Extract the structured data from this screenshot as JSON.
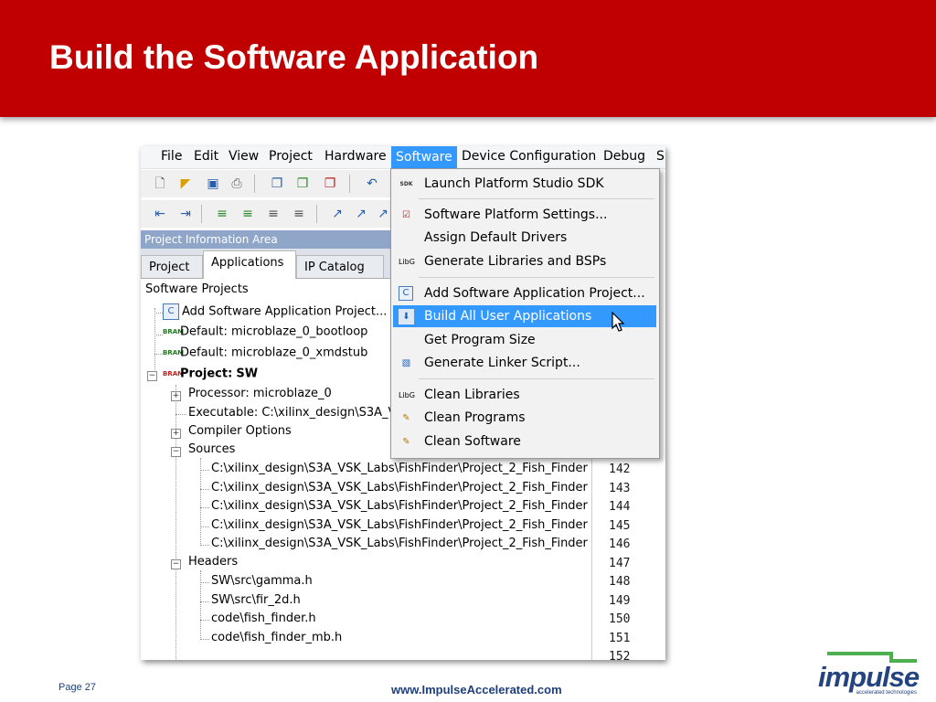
{
  "slide": {
    "title": "Build the Software Application",
    "page": "Page 27",
    "url": "www.ImpulseAccelerated.com",
    "logo_text": "impulse",
    "logo_tagline": "accelerated technologies",
    "header_color": "#c00000"
  },
  "menubar": [
    "File",
    "Edit",
    "View",
    "Project",
    "Hardware",
    "Software",
    "Device Configuration",
    "Debug",
    "S"
  ],
  "active_menu": "Software",
  "project_area": {
    "title": "Project Information Area",
    "tabs": [
      "Project",
      "Applications",
      "IP Catalog"
    ],
    "selected_tab": "Applications"
  },
  "tree": {
    "header": "Software Projects",
    "add_item": "Add Software Application Project...",
    "default1": "Default: microblaze_0_bootloop",
    "default2": "Default: microblaze_0_xmdstub",
    "project_label": "Project",
    "project_sep": ":",
    "project_name": "SW",
    "processor": "Processor: microblaze_0",
    "executable": "Executable: C:\\xilinx_design\\S3A_V",
    "compiler": "Compiler Options",
    "sources": "Sources",
    "source_files": [
      "C:\\xilinx_design\\S3A_VSK_Labs\\FishFinder\\Project_2_Fish_Finder",
      "C:\\xilinx_design\\S3A_VSK_Labs\\FishFinder\\Project_2_Fish_Finder",
      "C:\\xilinx_design\\S3A_VSK_Labs\\FishFinder\\Project_2_Fish_Finder",
      "C:\\xilinx_design\\S3A_VSK_Labs\\FishFinder\\Project_2_Fish_Finder",
      "C:\\xilinx_design\\S3A_VSK_Labs\\FishFinder\\Project_2_Fish_Finder"
    ],
    "headers": "Headers",
    "header_files": [
      "SW\\src\\gamma.h",
      "SW\\src\\fir_2d.h",
      "code\\fish_finder.h",
      "code\\fish_finder_mb.h"
    ]
  },
  "line_numbers": [
    "142",
    "143",
    "144",
    "145",
    "146",
    "147",
    "148",
    "149",
    "150",
    "151",
    "152"
  ],
  "software_menu": {
    "launch": "Launch Platform Studio SDK",
    "platform_settings": "Software Platform Settings...",
    "assign_drivers": "Assign Default Drivers",
    "gen_libs": "Generate Libraries and BSPs",
    "add_app": "Add Software Application Project...",
    "build_all": "Build All User Applications",
    "program_size": "Get Program Size",
    "linker": "Generate Linker Script...",
    "clean_libs": "Clean Libraries",
    "clean_programs": "Clean Programs",
    "clean_software": "Clean Software",
    "highlighted": "Build All User Applications"
  },
  "icon_labels": {
    "sdk": "SDK",
    "bram": "BRAM",
    "libg": "LibG",
    "c": "C"
  }
}
